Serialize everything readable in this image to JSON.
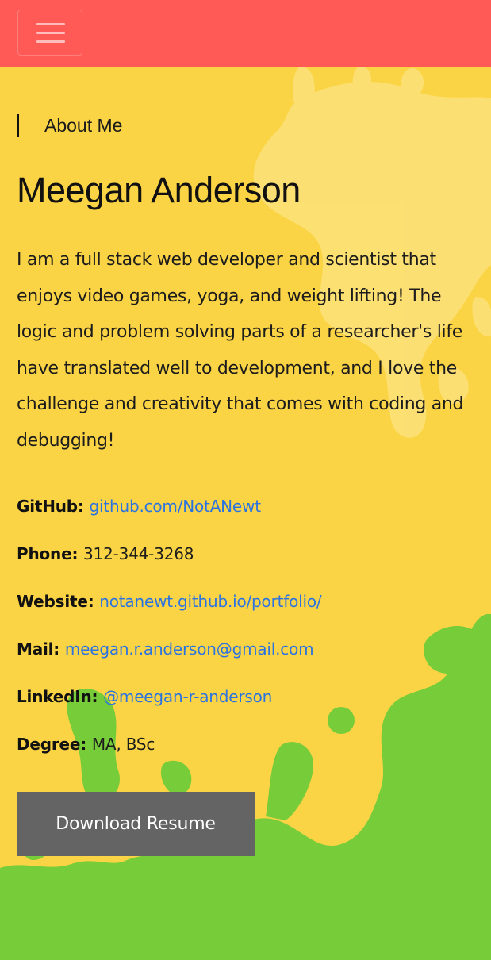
{
  "nav": {
    "menu_icon": "hamburger-menu-icon"
  },
  "about": {
    "section_label": "About Me",
    "name": "Meegan Anderson",
    "bio": "I am a full stack web developer and scientist that enjoys video games, yoga, and weight lifting! The logic and problem solving parts of a researcher's life have translated well to development, and I love the challenge and creativity that comes with coding and debugging!"
  },
  "info": [
    {
      "label": "GitHub:",
      "value": "github.com/NotANewt",
      "is_link": true
    },
    {
      "label": "Phone:",
      "value": "312-344-3268",
      "is_link": false
    },
    {
      "label": "Website:",
      "value": "notanewt.github.io/portfolio/",
      "is_link": true
    },
    {
      "label": "Mail:",
      "value": "meegan.r.anderson@gmail.com",
      "is_link": true
    },
    {
      "label": "LinkedIn:",
      "value": "@meegan-r-anderson",
      "is_link": true
    },
    {
      "label": "Degree:",
      "value": "MA, BSc",
      "is_link": false
    }
  ],
  "resume_button": "Download Resume",
  "colors": {
    "nav_background": "#ff5a56",
    "page_background": "#fbd445",
    "splash_green": "#77cc3a",
    "link": "#2b73e0",
    "button": "#646464"
  }
}
